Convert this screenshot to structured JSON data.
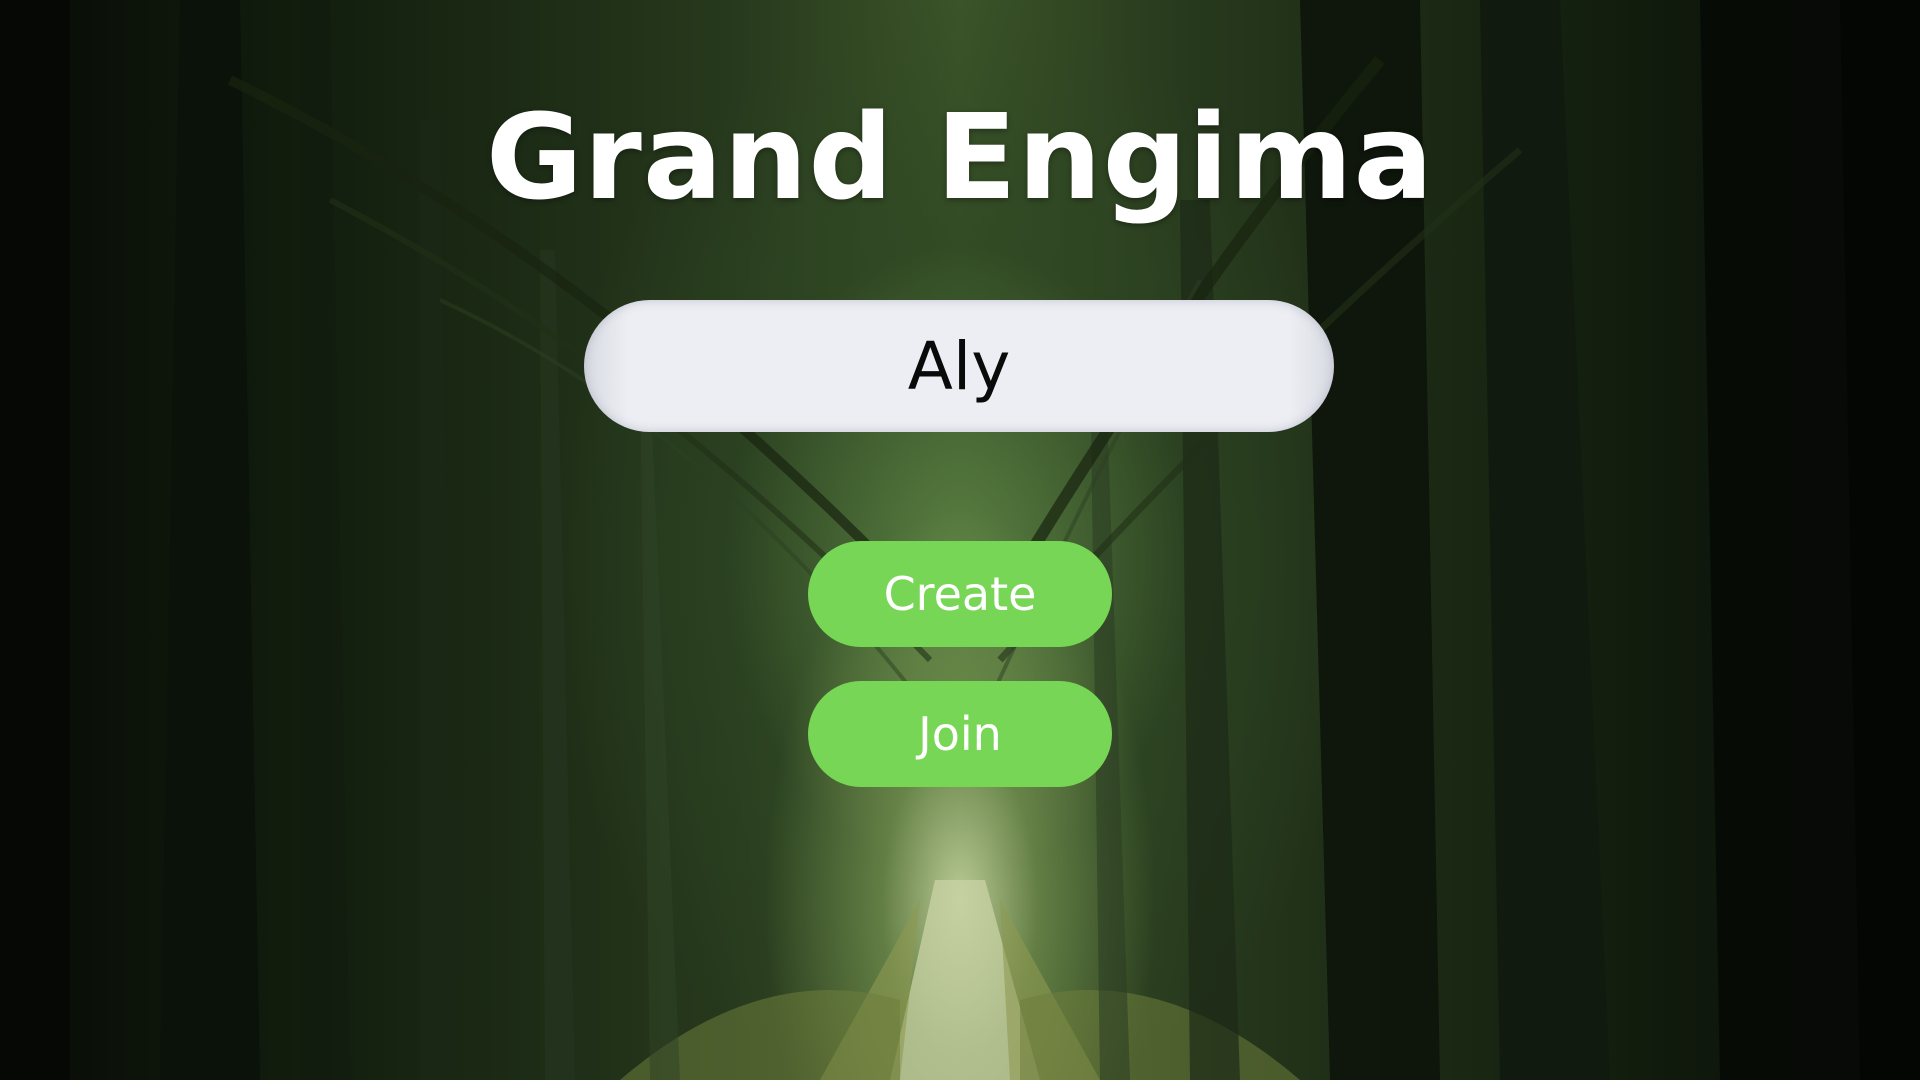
{
  "game": {
    "title": "Grand Engima"
  },
  "name_input": {
    "value": "Aly"
  },
  "buttons": {
    "create_label": "Create",
    "join_label": "Join"
  },
  "theme": {
    "button_color": "#77d655",
    "input_color": "#eceef3",
    "title_color": "#ffffff",
    "background": "forest-path-image"
  }
}
